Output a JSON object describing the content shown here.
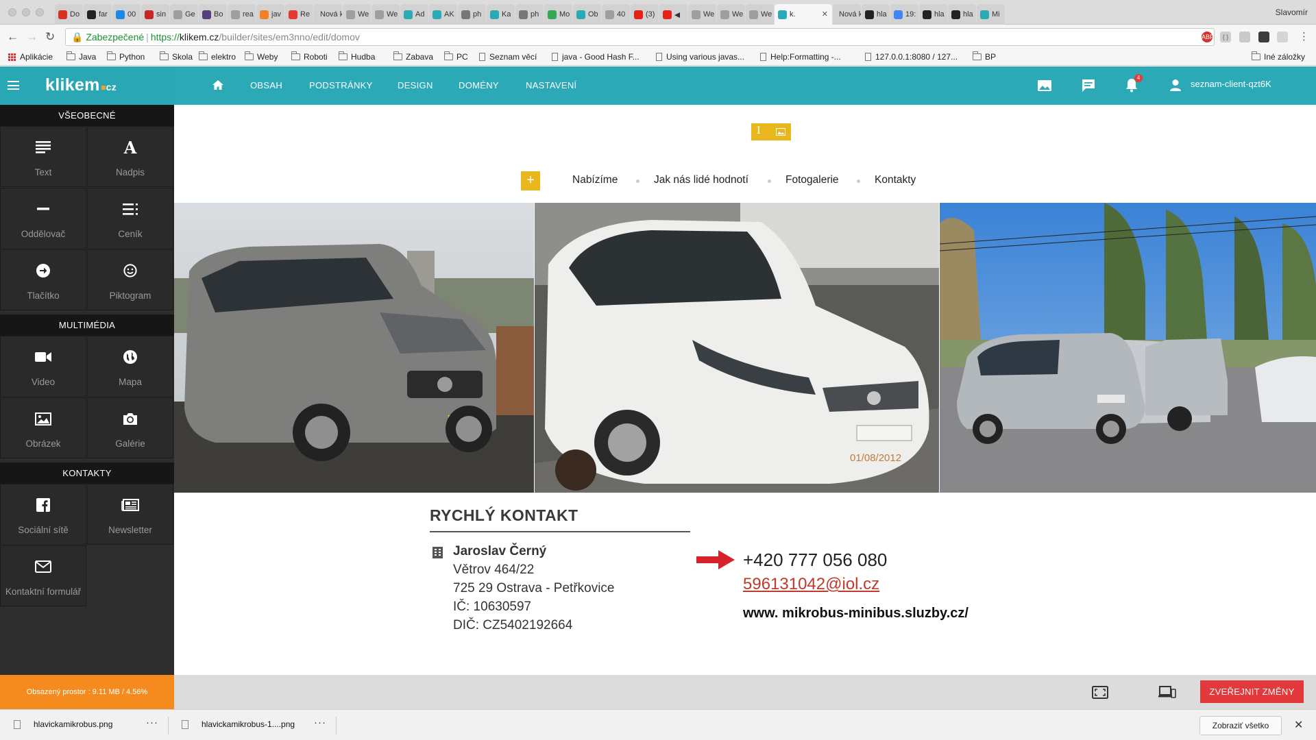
{
  "browser": {
    "profile_name": "Slavomír",
    "tabs": [
      {
        "title": "Do",
        "icon": "gmail-icon",
        "color": "#d93025"
      },
      {
        "title": "far",
        "icon": "github-icon",
        "color": "#222222"
      },
      {
        "title": "00",
        "icon": "circle-icon",
        "color": "#1e88e5"
      },
      {
        "title": "sin",
        "icon": "n-icon",
        "color": "#c62828"
      },
      {
        "title": "Ge",
        "icon": "page-icon",
        "color": "#9e9e9e"
      },
      {
        "title": "Bo",
        "icon": "bootstrap-icon",
        "color": "#563d7c"
      },
      {
        "title": "rea",
        "icon": "gear-icon",
        "color": "#9e9e9e"
      },
      {
        "title": "jav",
        "icon": "stackoverflow-icon",
        "color": "#f48024"
      },
      {
        "title": "Re",
        "icon": "dots-icon",
        "color": "#e53935"
      },
      {
        "title": "Nová k",
        "icon": "none",
        "color": "#d2d2d2"
      },
      {
        "title": "We",
        "icon": "page-icon",
        "color": "#9e9e9e"
      },
      {
        "title": "We",
        "icon": "page-icon",
        "color": "#9e9e9e"
      },
      {
        "title": "Ad",
        "icon": "klikem-icon",
        "color": "#2ba9b6"
      },
      {
        "title": "AK",
        "icon": "klikem-icon",
        "color": "#2ba9b6"
      },
      {
        "title": "ph",
        "icon": "shield-icon",
        "color": "#777777"
      },
      {
        "title": "Ka",
        "icon": "klikem-icon",
        "color": "#2ba9b6"
      },
      {
        "title": "ph",
        "icon": "shield-icon",
        "color": "#777777"
      },
      {
        "title": "Mo",
        "icon": "drive-icon",
        "color": "#34a853"
      },
      {
        "title": "Ob",
        "icon": "klikem-icon",
        "color": "#2ba9b6"
      },
      {
        "title": "40",
        "icon": "page-icon",
        "color": "#9e9e9e"
      },
      {
        "title": "(3)",
        "icon": "youtube-icon",
        "color": "#e62117"
      },
      {
        "title": "◀",
        "icon": "youtube-icon",
        "color": "#e62117"
      },
      {
        "title": "We",
        "icon": "page-icon",
        "color": "#9e9e9e"
      },
      {
        "title": "We",
        "icon": "page-icon",
        "color": "#9e9e9e"
      },
      {
        "title": "We",
        "icon": "page-icon",
        "color": "#9e9e9e"
      },
      {
        "title": "k.",
        "icon": "klikem-icon",
        "color": "#2ba9b6",
        "active": true
      },
      {
        "title": "Nová k",
        "icon": "none",
        "color": "#d2d2d2"
      },
      {
        "title": "hla",
        "icon": "s-icon",
        "color": "#222222"
      },
      {
        "title": "19:",
        "icon": "google-icon",
        "color": "#4285f4"
      },
      {
        "title": "hla",
        "icon": "s-icon",
        "color": "#222222"
      },
      {
        "title": "hla",
        "icon": "s-icon",
        "color": "#222222"
      },
      {
        "title": "Mi",
        "icon": "klikem-icon",
        "color": "#2ba9b6"
      }
    ],
    "address": {
      "secure_label": "Zabezpečené",
      "url_scheme": "https://",
      "url_host": "klikem.cz",
      "url_path": "/builder/sites/em3nno/edit/domov"
    },
    "bookmarks": [
      {
        "label": "Aplikácie",
        "type": "apps"
      },
      {
        "label": "Java",
        "type": "folder"
      },
      {
        "label": "Python",
        "type": "folder"
      },
      {
        "label": "Skola",
        "type": "folder"
      },
      {
        "label": "elektro",
        "type": "folder"
      },
      {
        "label": "Weby",
        "type": "folder"
      },
      {
        "label": "Roboti",
        "type": "folder"
      },
      {
        "label": "Hudba",
        "type": "folder"
      },
      {
        "label": "Zabava",
        "type": "folder"
      },
      {
        "label": "PC",
        "type": "folder"
      },
      {
        "label": "Seznam věcí",
        "type": "page"
      },
      {
        "label": "java - Good Hash F...",
        "type": "page"
      },
      {
        "label": "Using various javas...",
        "type": "page"
      },
      {
        "label": "Help:Formatting -...",
        "type": "page"
      },
      {
        "label": "127.0.0.1:8080 / 127...",
        "type": "page"
      },
      {
        "label": "BP",
        "type": "folder"
      }
    ],
    "other_bookmarks": "Iné záložky"
  },
  "app": {
    "logo_main": "klikem",
    "logo_suffix": "cz",
    "nav": [
      "OBSAH",
      "PODSTRÁNKY",
      "DESIGN",
      "DOMÉNY",
      "NASTAVENÍ"
    ],
    "notification_count": "4",
    "user": "seznam-client-qzt6K",
    "accent": "#2ba9b6",
    "sidebar": {
      "sections": [
        {
          "title": "VŠEOBECNÉ",
          "items": [
            "Text",
            "Nadpis",
            "Oddělovač",
            "Ceník",
            "Tlačítko",
            "Piktogram"
          ]
        },
        {
          "title": "MULTIMÉDIA",
          "items": [
            "Video",
            "Mapa",
            "Obrázek",
            "Galérie"
          ]
        },
        {
          "title": "KONTAKTY",
          "items": [
            "Sociální sítě",
            "Newsletter",
            "Kontaktní formulář"
          ]
        }
      ],
      "storage": "Obsazený prostor : 9.11 MB / 4.56%"
    },
    "publish_label": "ZVEŘEJNIT ZMĚNY"
  },
  "site": {
    "nav": [
      "Nabízíme",
      "Jak nás lidé hodnotí",
      "Fotogalerie",
      "Kontakty"
    ],
    "photo_date_stamp": "01/08/2012",
    "contact": {
      "title": "RYCHLÝ KONTAKT",
      "name": "Jaroslav Černý",
      "street": "Větrov 464/22",
      "city": "725 29 Ostrava - Petřkovice",
      "ico": "IČ: 10630597",
      "dic": "DIČ: CZ5402192664",
      "phone": "+420 777 056 080",
      "email": "596131042@iol.cz",
      "web": "www. mikrobus-minibus.sluzby.cz/"
    }
  },
  "downloads": {
    "items": [
      "hlavickamikrobus.png",
      "hlavickamikrobus-1....png"
    ],
    "show_all": "Zobraziť všetko"
  }
}
